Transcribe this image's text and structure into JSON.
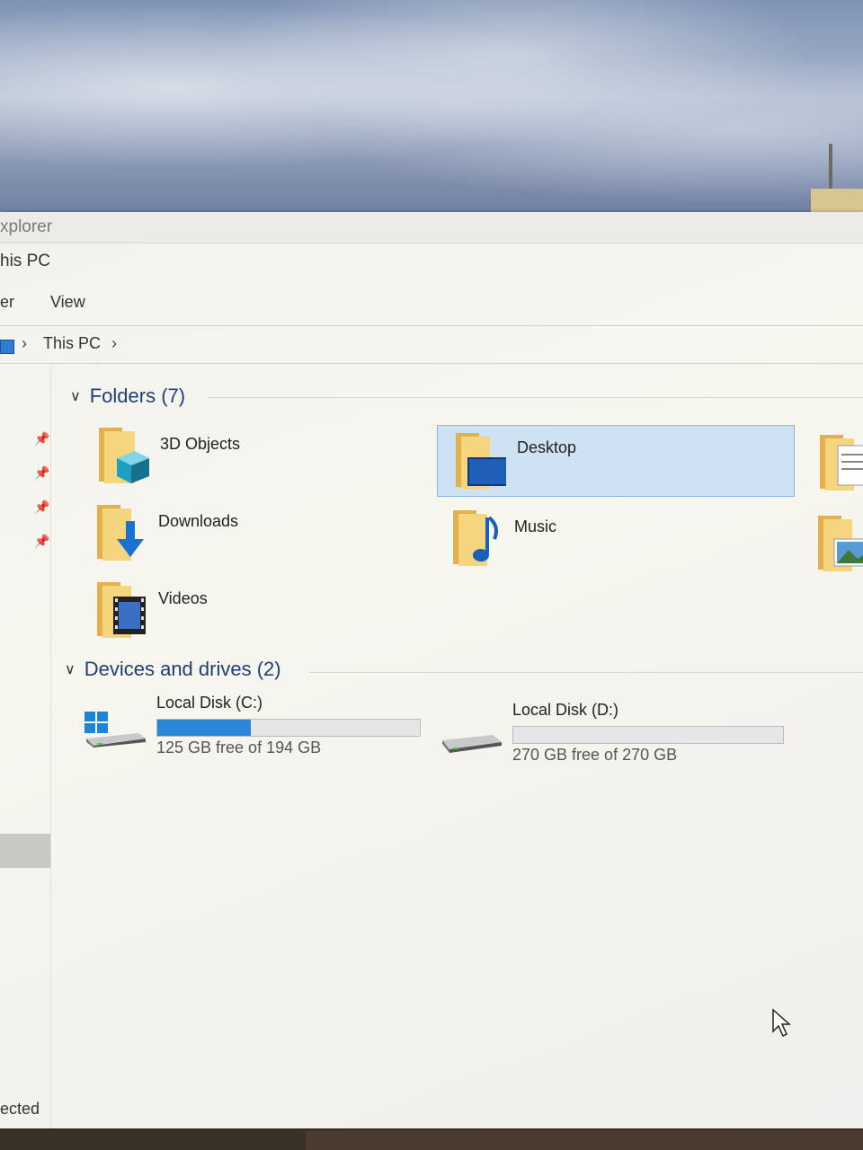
{
  "window": {
    "title": "xplorer",
    "tab_title": "his PC",
    "ribbon": {
      "tab_partial": "er",
      "view": "View"
    },
    "address": {
      "crumb": "This PC",
      "separator": "›"
    }
  },
  "groups": {
    "folders": {
      "title": "Folders (7)",
      "items": [
        {
          "label": "3D Objects",
          "icon": "3d-objects-folder-icon"
        },
        {
          "label": "Desktop",
          "icon": "desktop-folder-icon",
          "selected": true
        },
        {
          "label": "Downloads",
          "icon": "downloads-folder-icon"
        },
        {
          "label": "Music",
          "icon": "music-folder-icon"
        },
        {
          "label": "Videos",
          "icon": "videos-folder-icon"
        }
      ]
    },
    "drives": {
      "title": "Devices and drives (2)",
      "items": [
        {
          "name": "Local Disk (C:)",
          "free_text": "125 GB free of 194 GB",
          "used_fraction": 0.356,
          "icon": "windows-drive-icon"
        },
        {
          "name": "Local Disk (D:)",
          "free_text": "270 GB free of 270 GB",
          "used_fraction": 0.0,
          "icon": "drive-icon"
        }
      ]
    }
  },
  "status": {
    "text": "ected"
  },
  "colors": {
    "accent": "#2a86d8",
    "selection": "#cfe2f3",
    "header_text": "#1e3f73"
  }
}
